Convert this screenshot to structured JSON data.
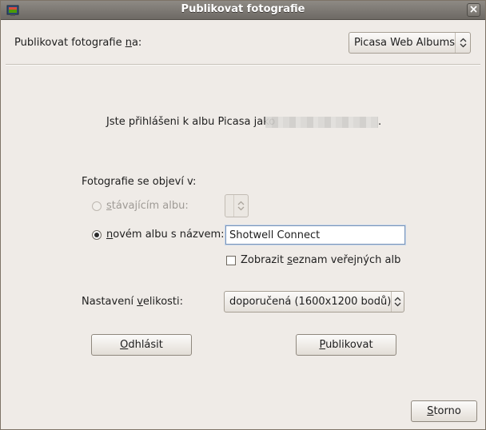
{
  "window": {
    "title": "Publikovat fotografie"
  },
  "publish_to": {
    "label_prefix": "Publikovat fotografie ",
    "label_mnemonic": "n",
    "label_suffix": "a:",
    "service": "Picasa Web Albums"
  },
  "login_message": {
    "text": "Jste přihlášeni k albu Picasa jako",
    "suffix": "."
  },
  "destination": {
    "heading": "Fotografie se objeví v:",
    "existing_album": {
      "label_mnemonic": "s",
      "label_rest": "távajícím albu:",
      "selected": false,
      "enabled": false
    },
    "new_album": {
      "label_mnemonic": "n",
      "label_rest": "ovém albu s názvem:",
      "selected": true,
      "name_value": "Shotwell Connect"
    },
    "public_albums_checkbox": {
      "label_prefix": "Zobrazit ",
      "label_mnemonic": "s",
      "label_rest": "eznam veřejných alb",
      "checked": false
    }
  },
  "size": {
    "label_prefix": "Nastavení ",
    "label_mnemonic": "v",
    "label_rest": "elikosti:",
    "selected": "doporučená (1600x1200 bodů)"
  },
  "buttons": {
    "logout_mnemonic": "O",
    "logout_rest": "dhlásit",
    "publish_mnemonic": "P",
    "publish_rest": "ublikovat",
    "cancel_mnemonic": "S",
    "cancel_rest": "torno"
  },
  "icons": {
    "app": "shotwell-app-icon",
    "close": "close-icon",
    "combo": "updown-arrows-icon"
  }
}
